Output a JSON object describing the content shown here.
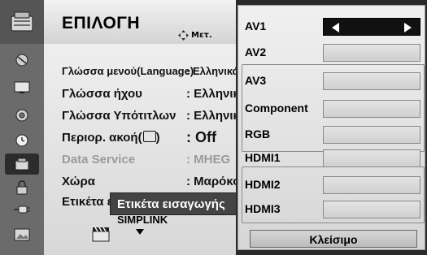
{
  "menu": {
    "title": "ΕΠΙΛΟΓΗ",
    "move_hint": "Μετ.",
    "categories": [
      {
        "icon": "satellite-dish-icon",
        "active": false
      },
      {
        "icon": "tv-screen-icon",
        "active": false
      },
      {
        "icon": "audio-speaker-icon",
        "active": false
      },
      {
        "icon": "clock-icon",
        "active": false
      },
      {
        "icon": "options-box-icon",
        "active": true
      },
      {
        "icon": "lock-icon",
        "active": false
      },
      {
        "icon": "usb-plug-icon",
        "active": false
      },
      {
        "icon": "photo-frame-icon",
        "active": false
      }
    ],
    "rows": [
      {
        "label": "Γλώσσα μενού(Language)",
        "value": ": Ελληνικά",
        "small": true,
        "dim": false
      },
      {
        "label": "Γλώσσα ήχου",
        "value": ": Ελληνικά",
        "small": false,
        "dim": false
      },
      {
        "label": "Γλώσσα Υπότιτλων",
        "value": ": Ελληνικά",
        "small": false,
        "dim": false
      },
      {
        "label": "Περιορ. ακοή(",
        "value": ": Off",
        "small": false,
        "dim": false
      },
      {
        "label": "Data Service",
        "value": ": MHEG",
        "small": false,
        "dim": true
      },
      {
        "label": "Χώρα",
        "value": ": Μαρόκο",
        "small": false,
        "dim": false
      },
      {
        "label": "Ετικέτα εισ",
        "value": "",
        "small": false,
        "dim": false
      }
    ],
    "closed_caption_suffix": ")",
    "tooltip": "Ετικέτα εισαγωγής",
    "simplink": "SIMPLINK"
  },
  "inputs": {
    "items": [
      {
        "name": "AV1",
        "selected": true
      },
      {
        "name": "AV2",
        "selected": false
      },
      {
        "name": "AV3",
        "selected": false
      },
      {
        "name": "Component",
        "selected": false
      },
      {
        "name": "RGB",
        "selected": false
      },
      {
        "name": "HDMI1",
        "selected": false
      },
      {
        "name": "HDMI2",
        "selected": false
      },
      {
        "name": "HDMI3",
        "selected": false
      }
    ],
    "close_label": "Κλείσιμο"
  }
}
